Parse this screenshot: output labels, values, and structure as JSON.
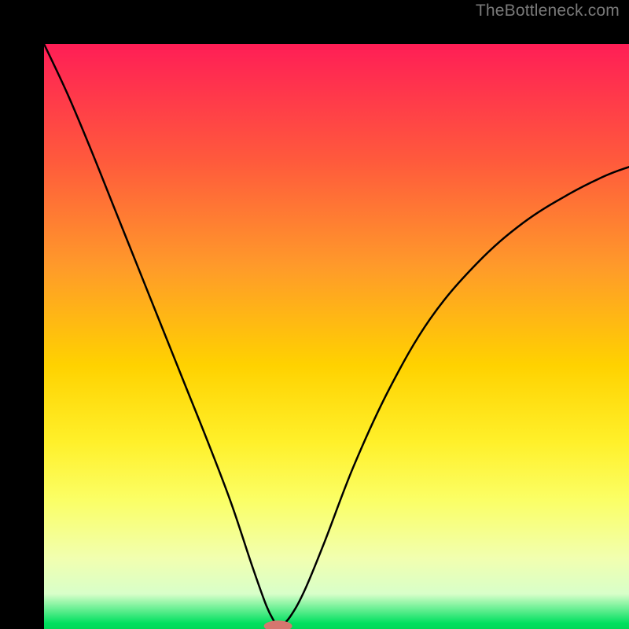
{
  "watermark": "TheBottleneck.com",
  "chart_data": {
    "type": "line",
    "title": "",
    "xlabel": "",
    "ylabel": "",
    "xlim": [
      0,
      1
    ],
    "ylim": [
      0,
      1
    ],
    "notch": {
      "x": 0.4,
      "y": 0.0
    },
    "marker": {
      "x": 0.4,
      "y": 0.005,
      "color": "#d6766f",
      "rx": 18,
      "ry": 7
    },
    "series": [
      {
        "name": "left-branch",
        "x": [
          0.0,
          0.04,
          0.08,
          0.12,
          0.16,
          0.2,
          0.24,
          0.28,
          0.32,
          0.355,
          0.38,
          0.395,
          0.4
        ],
        "y": [
          1.0,
          0.915,
          0.82,
          0.72,
          0.62,
          0.52,
          0.42,
          0.32,
          0.215,
          0.11,
          0.04,
          0.01,
          0.0
        ]
      },
      {
        "name": "right-branch",
        "x": [
          0.4,
          0.42,
          0.445,
          0.48,
          0.53,
          0.59,
          0.66,
          0.74,
          0.82,
          0.9,
          0.96,
          1.0
        ],
        "y": [
          0.0,
          0.02,
          0.065,
          0.15,
          0.28,
          0.41,
          0.53,
          0.625,
          0.695,
          0.745,
          0.775,
          0.79
        ]
      }
    ],
    "gradient_stops": [
      {
        "pos": 0.0,
        "color": "#ff1e56"
      },
      {
        "pos": 0.2,
        "color": "#ff5a3c"
      },
      {
        "pos": 0.38,
        "color": "#ff9a2a"
      },
      {
        "pos": 0.55,
        "color": "#ffd200"
      },
      {
        "pos": 0.68,
        "color": "#fff02a"
      },
      {
        "pos": 0.78,
        "color": "#fbff66"
      },
      {
        "pos": 0.88,
        "color": "#f1ffb0"
      },
      {
        "pos": 0.94,
        "color": "#d8ffc9"
      },
      {
        "pos": 0.99,
        "color": "#00e060"
      },
      {
        "pos": 1.0,
        "color": "#00d858"
      }
    ]
  }
}
